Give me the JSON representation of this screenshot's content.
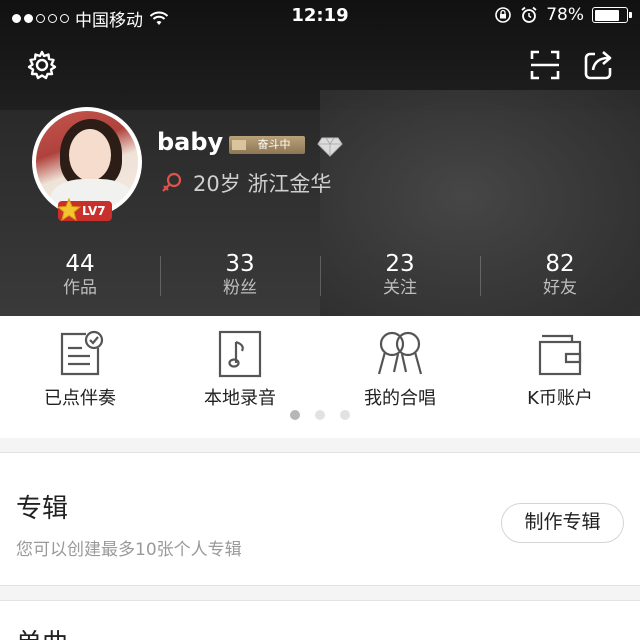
{
  "status_bar": {
    "carrier": "中国移动",
    "time": "12:19",
    "battery": "78%",
    "battery_level": 0.78
  },
  "top_icons": [
    "gear-icon",
    "scan-icon",
    "share-icon"
  ],
  "profile": {
    "username": "baby",
    "rank_badge": "奋斗中",
    "level": "LV7",
    "age_location": "20岁 浙江金华"
  },
  "stats": [
    {
      "num": "44",
      "label": "作品"
    },
    {
      "num": "33",
      "label": "粉丝"
    },
    {
      "num": "23",
      "label": "关注"
    },
    {
      "num": "82",
      "label": "好友"
    }
  ],
  "actions": [
    {
      "label": "已点伴奏",
      "icon": "accompaniment-list-icon"
    },
    {
      "label": "本地录音",
      "icon": "local-recording-icon"
    },
    {
      "label": "我的合唱",
      "icon": "chorus-icon"
    },
    {
      "label": "K币账户",
      "icon": "wallet-icon"
    }
  ],
  "pager": {
    "count": 3,
    "active": 0
  },
  "album": {
    "title": "专辑",
    "subtitle": "您可以创建最多10张个人专辑",
    "button": "制作专辑"
  },
  "single": {
    "title": "单曲"
  },
  "colors": {
    "header_bg": "#2b2b2b",
    "level_badge": "#c9302c",
    "gender_icon": "#e0534c"
  }
}
